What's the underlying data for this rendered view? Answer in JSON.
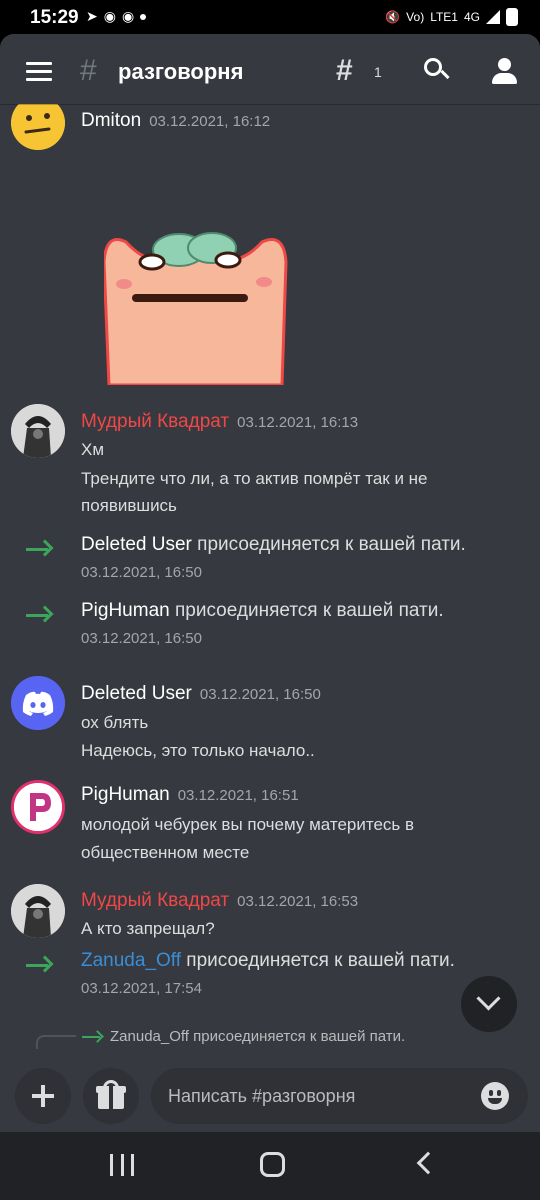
{
  "status_bar": {
    "time": "15:29",
    "network": "LTE1",
    "net_type": "4G",
    "volte": "Vo)",
    "icons": [
      "signal-icon",
      "wifi-icon",
      "battery-icon"
    ]
  },
  "header": {
    "channel_name": "разговорня",
    "threads_count": "1"
  },
  "messages": [
    {
      "type": "message",
      "author": "Dmiton",
      "timestamp": "03.12.2021, 16:12",
      "lines": [],
      "sticker": "cat-sticker"
    },
    {
      "type": "message",
      "author": "Мудрый Квадрат",
      "author_color": "#f04747",
      "timestamp": "03.12.2021, 16:13",
      "lines": [
        "Хм",
        "Трендите что ли, а то актив помрёт так и не",
        "появившись"
      ]
    },
    {
      "type": "join",
      "name": "Deleted User",
      "text": "присоединяется к вашей пати.",
      "timestamp": "03.12.2021, 16:50"
    },
    {
      "type": "join",
      "name": "PigHuman",
      "text": "присоединяется к вашей пати.",
      "timestamp": "03.12.2021, 16:50"
    },
    {
      "type": "message",
      "author": "Deleted User",
      "timestamp": "03.12.2021, 16:50",
      "lines": [
        "ох блять",
        "Надеюсь, это только начало.."
      ]
    },
    {
      "type": "message",
      "author": "PigHuman",
      "timestamp": "03.12.2021, 16:51",
      "lines": [
        "молодой чебурек вы почему материтесь в",
        "общественном месте"
      ]
    },
    {
      "type": "message",
      "author": "Мудрый Квадрат",
      "author_color": "#f04747",
      "timestamp": "03.12.2021, 16:53",
      "lines": [
        "А кто запрещал?"
      ]
    },
    {
      "type": "join",
      "name": "Zanuda_Off",
      "name_color": "#3b8dd6",
      "text": "присоединяется к вашей пати.",
      "timestamp": "03.12.2021, 17:54"
    }
  ],
  "reply_preview": "Zanuda_Off присоединяется к вашей пати.",
  "composer": {
    "placeholder": "Написать #разговорня"
  },
  "colors": {
    "background": "#36393f",
    "join_arrow": "#3ba55c",
    "discord_blurple": "#5865f2",
    "pighuman_ring": "#e2306c"
  }
}
